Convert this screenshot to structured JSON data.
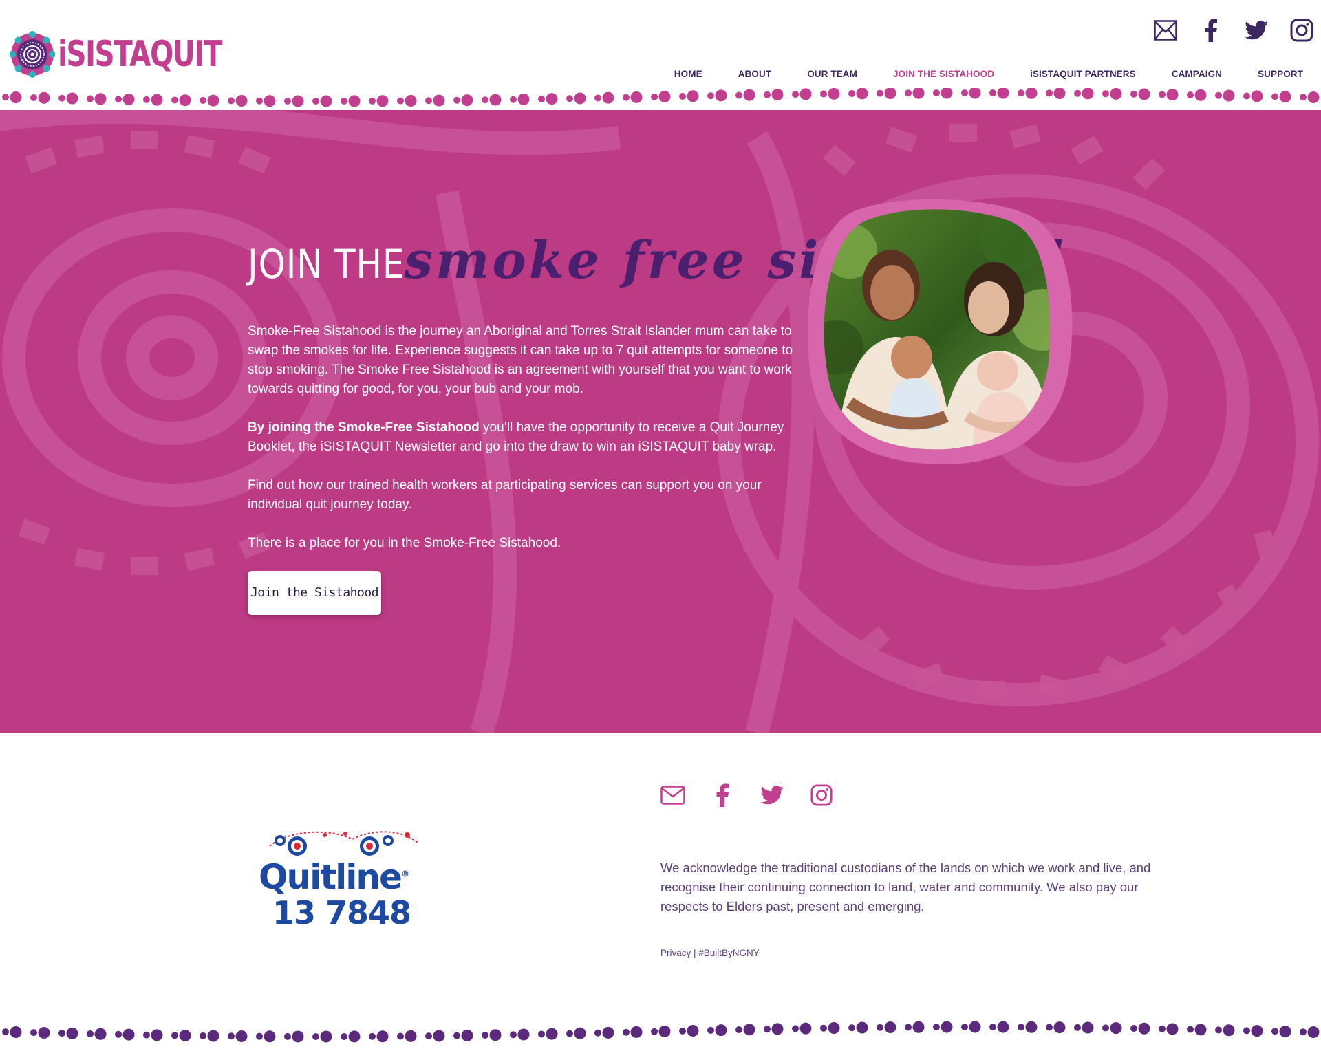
{
  "brand": {
    "logo_text": "iSISTAQUIT",
    "primary": "#c13f8e",
    "dark_purple": "#3d2760",
    "hero_bg": "#bd3a85"
  },
  "header": {
    "social_icons": [
      "mail-icon",
      "facebook-icon",
      "twitter-icon",
      "instagram-icon"
    ],
    "nav": [
      {
        "label": "HOME",
        "active": false
      },
      {
        "label": "ABOUT",
        "active": false
      },
      {
        "label": "OUR TEAM",
        "active": false
      },
      {
        "label": "JOIN THE SISTAHOOD",
        "active": true
      },
      {
        "label": "iSISTAQUIT PARTNERS",
        "active": false
      },
      {
        "label": "CAMPAIGN",
        "active": false
      },
      {
        "label": "SUPPORT",
        "active": false
      }
    ]
  },
  "hero": {
    "title_plain": "JOIN THE",
    "title_script": "smoke free sistahood",
    "p1": "Smoke-Free Sistahood is the journey an Aboriginal and Torres Strait Islander mum can take to swap the smokes for life. Experience suggests it can take up to 7 quit attempts for someone to stop smoking. The Smoke Free Sistahood is an agreement with yourself that you want to work towards quitting for good, for you, your bub and your mob.",
    "p2_bold": "By joining the Smoke-Free Sistahood",
    "p2_rest": " you’ll have the opportunity to receive a Quit Journey Booklet, the iSISTAQUIT Newsletter and go into the draw to win an iSISTAQUIT baby wrap.",
    "p3": "Find out how our trained health workers at participating services can support you on your individual quit journey today.",
    "p4": "There is a place for you in the Smoke-Free Sistahood.",
    "button_label": "Join the Sistahood"
  },
  "footer": {
    "social_icons": [
      "mail-icon",
      "facebook-icon",
      "twitter-icon",
      "instagram-icon"
    ],
    "quitline_word": "Quitline",
    "quitline_registered": "®",
    "quitline_number": "13 7848",
    "acknowledgement": "We acknowledge the traditional custodians of the lands on which we work and live, and recognise their continuing connection to land, water and community. We also pay our respects to Elders past, present and emerging.",
    "privacy_label": "Privacy",
    "separator": " | ",
    "built_by": "#BuiltByNGNY"
  }
}
